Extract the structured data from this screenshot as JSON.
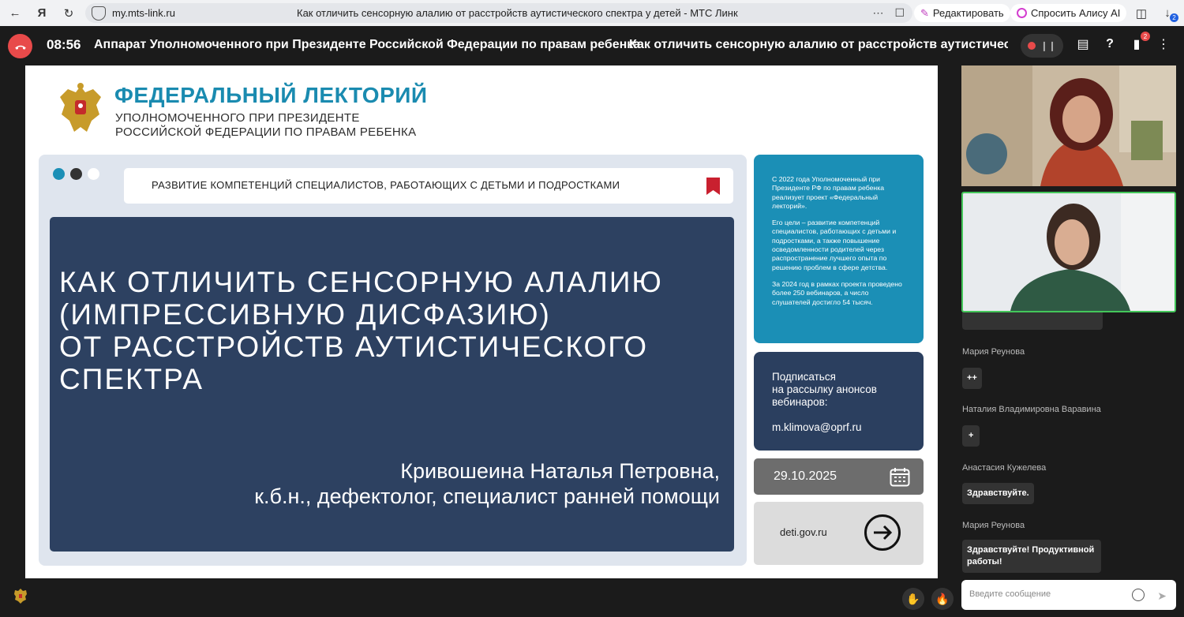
{
  "browser": {
    "url": "my.mts-link.ru",
    "tab_title": "Как отличить сенсорную алалию от расстройств аутистического спектра у детей - МТС Линк",
    "edit_label": "Редактировать",
    "alice_label": "Спросить Алису AI",
    "downloads_count": "2"
  },
  "meeting": {
    "time": "08:56",
    "organizer": "Аппарат Уполномоченного при Президенте Российской Федерации по правам ребенка",
    "title": "Как отличить сенсорную алалию от расстройств аутистическо",
    "notifications_count": "2"
  },
  "slide": {
    "lectorium_title": "ФЕДЕРАЛЬНЫЙ ЛЕКТОРИЙ",
    "lectorium_sub_line1": "УПОЛНОМОЧЕННОГО ПРИ ПРЕЗИДЕНТЕ",
    "lectorium_sub_line2": "РОССИЙСКОЙ ФЕДЕРАЦИИ ПО ПРАВАМ РЕБЕНКА",
    "topic": "РАЗВИТИЕ КОМПЕТЕНЦИЙ СПЕЦИАЛИСТОВ, РАБОТАЮЩИХ С ДЕТЬМИ И ПОДРОСТКАМИ",
    "title_line1": "КАК ОТЛИЧИТЬ СЕНСОРНУЮ АЛАЛИЮ",
    "title_line2": "(ИМПРЕССИВНУЮ ДИСФАЗИЮ)",
    "title_line3": "ОТ РАССТРОЙСТВ АУТИСТИЧЕСКОГО",
    "title_line4": "СПЕКТРА",
    "author_name": "Кривошеина Наталья Петровна,",
    "author_role": "к.б.н., дефектолог, специалист ранней помощи",
    "info_p1": "С 2022 года Уполномоченный при Президенте РФ по правам ребенка реализует проект «Федеральный лекторий».",
    "info_p2": "Его цели – развитие компетенций специалистов, работающих с детьми и подростками, а также повышение осведомленности родителей через распространение лучшего опыта по решению проблем в сфере детства.",
    "info_p3": "За 2024 год в рамках проекта проведено более 250 вебинаров, а число слушателей достигло 54 тысяч.",
    "subscribe_line1": "Подписаться",
    "subscribe_line2": "на рассылку анонсов",
    "subscribe_line3": "вебинаров:",
    "email": "m.klimova@oprf.ru",
    "date": "29.10.2025",
    "site": "deti.gov.ru",
    "colors": {
      "navy": "#2d4161",
      "accent_blue": "#1b8fb6",
      "bookmark_red": "#c9202f"
    }
  },
  "chat": {
    "messages": [
      {
        "author": "Мария Реунова",
        "text": "++"
      },
      {
        "author": "Наталия Владимировна Варавина",
        "text": "+"
      },
      {
        "author": "Анастасия Кужелева",
        "text": "Здравствуйте."
      },
      {
        "author": "Мария Реунова",
        "text": "Здравствуйте! Продуктивной работы!"
      }
    ],
    "input_placeholder": "Введите сообщение"
  }
}
